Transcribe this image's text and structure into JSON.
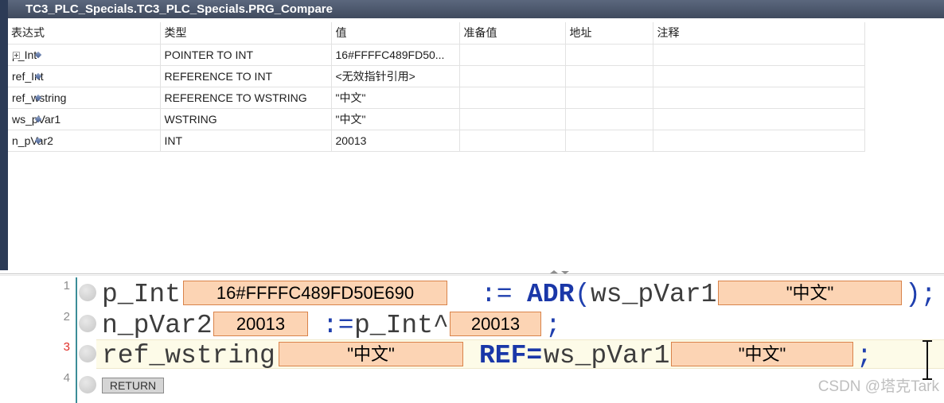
{
  "window": {
    "title": "TC3_PLC_Specials.TC3_PLC_Specials.PRG_Compare"
  },
  "watch_table": {
    "columns": {
      "expression": "表达式",
      "type": "类型",
      "value": "值",
      "prepared_value": "准备值",
      "address": "地址",
      "comment": "注释"
    },
    "rows": [
      {
        "expression": "p_Int",
        "type": "POINTER TO INT",
        "value": "16#FFFFC489FD50...",
        "prepared_value": "",
        "address": "",
        "comment": "",
        "expandable": true
      },
      {
        "expression": "ref_Int",
        "type": "REFERENCE TO INT",
        "value": "<无效指针引用>",
        "prepared_value": "",
        "address": "",
        "comment": "",
        "expandable": false
      },
      {
        "expression": "ref_wstring",
        "type": "REFERENCE TO WSTRING",
        "value": "\"中文\"",
        "prepared_value": "",
        "address": "",
        "comment": "",
        "expandable": false
      },
      {
        "expression": "ws_pVar1",
        "type": "WSTRING",
        "value": "\"中文\"",
        "prepared_value": "",
        "address": "",
        "comment": "",
        "expandable": false
      },
      {
        "expression": "n_pVar2",
        "type": "INT",
        "value": "20013",
        "prepared_value": "",
        "address": "",
        "comment": "",
        "expandable": false
      }
    ]
  },
  "editor": {
    "current_line": 3,
    "lines": [
      {
        "number": "1",
        "variable": "p_Int",
        "online_value": "16#FFFFC489FD50E690",
        "assign": ":=",
        "function": "ADR",
        "open_paren": "(",
        "argument": "ws_pVar1",
        "argument_value": "\"中文\"",
        "close": ");"
      },
      {
        "number": "2",
        "variable": "n_pVar2",
        "online_value": "20013",
        "assign": ":=",
        "source": "p_Int^",
        "source_value": "20013",
        "close": ";"
      },
      {
        "number": "3",
        "variable": "ref_wstring",
        "online_value": "\"中文\"",
        "assign": "REF=",
        "argument": "ws_pVar1",
        "argument_value": "\"中文\"",
        "close": ";"
      },
      {
        "number": "4",
        "return_label": "RETURN"
      }
    ]
  },
  "icons": {
    "expand": "expand-plus-icon",
    "variable": "variable-diamond-icon",
    "breakpoint": "breakpoint-marker-icon",
    "splitter": "splitter-handle-icon",
    "cursor": "text-cursor-icon"
  },
  "colors": {
    "title_bar": "#3f4a5e",
    "identifier": "#3d3d3d",
    "operator": "#1f3fae",
    "keyword": "#1a37a8",
    "online_value_background": "#fcd4b4",
    "online_value_border": "#d9834a",
    "current_line_background": "#fdfbe8",
    "current_line_number": "#e0302a",
    "gutter_line": "#3b8d98"
  },
  "watermark": "CSDN @塔克Tark"
}
